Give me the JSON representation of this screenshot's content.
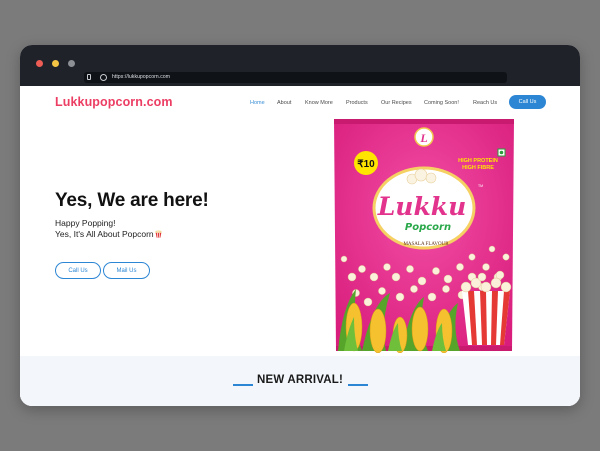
{
  "browser": {
    "url": "https://lukkupopcorn.com"
  },
  "site": {
    "logo": "Lukkupopcorn.com",
    "nav": [
      {
        "label": "Home",
        "active": true
      },
      {
        "label": "About",
        "active": false
      },
      {
        "label": "Know More",
        "active": false
      },
      {
        "label": "Products",
        "active": false
      },
      {
        "label": "Our Recipes",
        "active": false
      },
      {
        "label": "Coming Soon!",
        "active": false
      },
      {
        "label": "Reach Us",
        "active": false
      }
    ],
    "call_button": "Call Us"
  },
  "hero": {
    "title": "Yes, We are here!",
    "line1": "Happy Popping!",
    "line2": "Yes, It's All About Popcorn",
    "call_button": "Call Us",
    "mail_button": "Mail Us"
  },
  "product_pack": {
    "brand": "Lukku",
    "sub_brand": "Popcorn",
    "logo_letter": "L",
    "price": "₹10",
    "claim_1": "HIGH PROTEIN",
    "claim_2": "HIGH FIBRE",
    "flavour": "MASALA FLAVOUR",
    "tm": "TM"
  },
  "section": {
    "heading": "NEW ARRIVAL!"
  },
  "colors": {
    "brand_pink": "#ec3d63",
    "accent_blue": "#2c86d4",
    "pack_magenta": "#e2338d"
  }
}
